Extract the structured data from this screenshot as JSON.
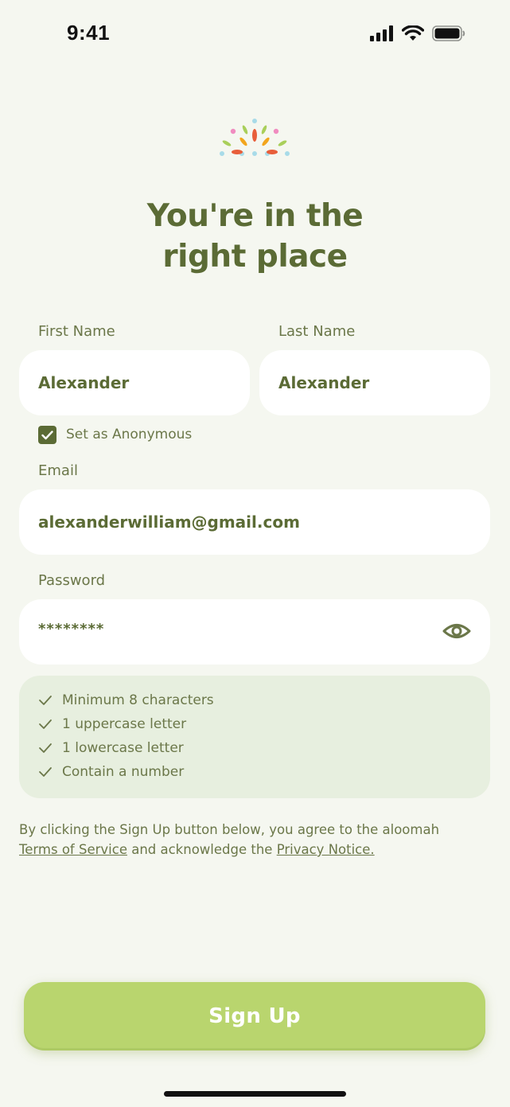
{
  "status_bar": {
    "time": "9:41"
  },
  "headline": {
    "line1": "You're in the",
    "line2": "right place"
  },
  "form": {
    "first_name": {
      "label": "First Name",
      "value": "Alexander"
    },
    "last_name": {
      "label": "Last Name",
      "value": "Alexander"
    },
    "anonymous": {
      "label": "Set as Anonymous",
      "checked": true
    },
    "email": {
      "label": "Email",
      "value": "alexanderwilliam@gmail.com"
    },
    "password": {
      "label": "Password",
      "value": "********"
    }
  },
  "password_rules": [
    "Minimum 8 characters",
    "1 uppercase letter",
    "1 lowercase letter",
    "Contain a number"
  ],
  "consent": {
    "text_before": "By clicking the Sign Up button below, you agree to the aloomah",
    "terms_link": "Terms of Service",
    "text_middle": " and acknowledge the ",
    "privacy_link": "Privacy Notice."
  },
  "signup_button": {
    "label": "Sign Up"
  },
  "colors": {
    "background": "#f5f7f0",
    "primary_text": "#5b6b35",
    "button": "#b9d56e",
    "rules_box": "#e7efdf"
  }
}
